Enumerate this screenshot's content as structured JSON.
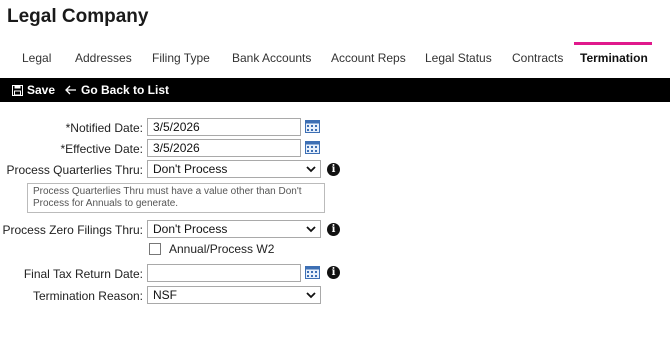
{
  "page": {
    "title": "Legal Company"
  },
  "tabs": [
    {
      "label": "Legal"
    },
    {
      "label": "Addresses"
    },
    {
      "label": "Filing Type"
    },
    {
      "label": "Bank Accounts"
    },
    {
      "label": "Account Reps"
    },
    {
      "label": "Legal Status"
    },
    {
      "label": "Contracts"
    },
    {
      "label": "Termination",
      "active": true
    }
  ],
  "toolbar": {
    "save_label": "Save",
    "back_label": "Go Back to List"
  },
  "form": {
    "notified_date": {
      "label": "*Notified Date:",
      "value": "3/5/2026"
    },
    "effective_date": {
      "label": "*Effective Date:",
      "value": "3/5/2026"
    },
    "process_quarterlies": {
      "label": "Process Quarterlies Thru:",
      "value": "Don't Process"
    },
    "hint": "Process Quarterlies Thru must have a value other than Don't Process for Annuals to generate.",
    "process_zero_filings": {
      "label": "Process Zero Filings Thru:",
      "value": "Don't Process"
    },
    "annual_process_w2": {
      "label": "Annual/Process W2",
      "checked": false
    },
    "final_tax_return_date": {
      "label": "Final Tax Return Date:",
      "value": ""
    },
    "termination_reason": {
      "label": "Termination Reason:",
      "value": "NSF"
    }
  },
  "colors": {
    "accent": "#e0198c",
    "toolbar_bg": "#000000"
  },
  "icons": [
    "save-icon",
    "arrow-left-icon",
    "calendar-icon",
    "chevron-down-icon",
    "info-icon"
  ]
}
